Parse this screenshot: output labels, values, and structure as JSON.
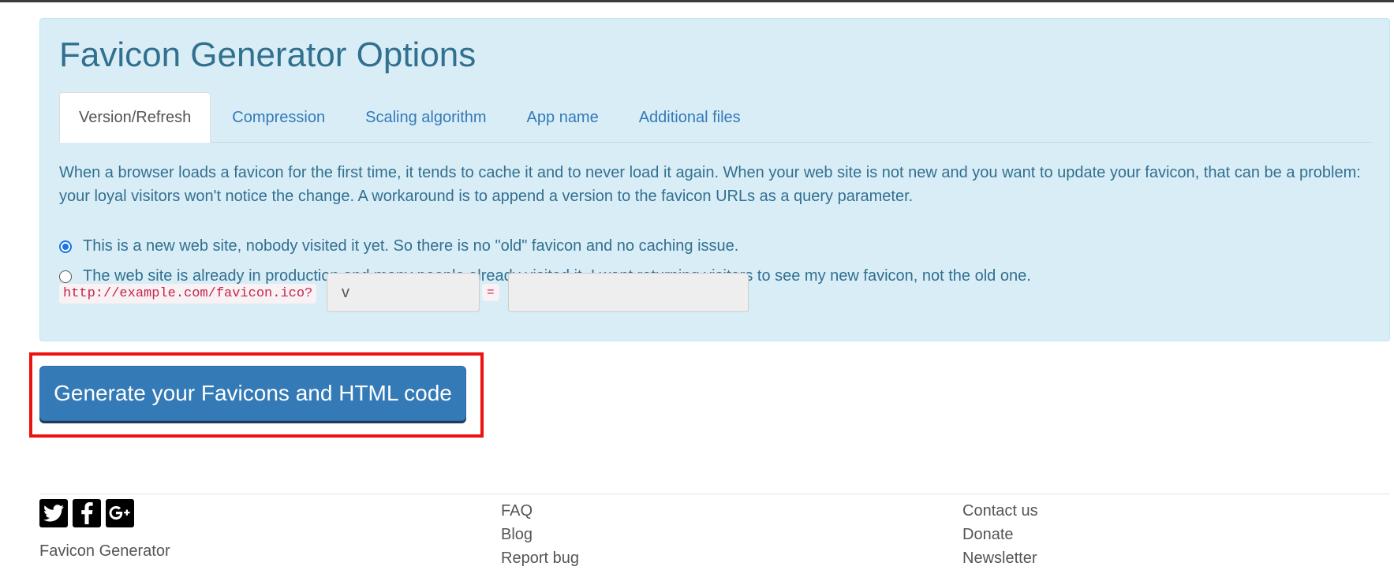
{
  "options": {
    "title": "Favicon Generator Options",
    "tabs": [
      {
        "label": "Version/Refresh",
        "active": true
      },
      {
        "label": "Compression",
        "active": false
      },
      {
        "label": "Scaling algorithm",
        "active": false
      },
      {
        "label": "App name",
        "active": false
      },
      {
        "label": "Additional files",
        "active": false
      }
    ],
    "description": "When a browser loads a favicon for the first time, it tends to cache it and to never load it again. When your web site is not new and you want to update your favicon, that can be a problem: your loyal visitors won't notice the change. A workaround is to append a version to the favicon URLs as a query parameter.",
    "radio_new_site": {
      "label": "This is a new web site, nobody visited it yet. So there is no \"old\" favicon and no caching issue.",
      "checked": true
    },
    "radio_production": {
      "label": "The web site is already in production and many people already visited it. I want returning visitors to see my new favicon, not the old one.",
      "checked": false
    },
    "url_prefix": "http://example.com/favicon.ico?",
    "param_name": "v",
    "equals_sign": "=",
    "param_value": ""
  },
  "generate_button": {
    "label": "Generate your Favicons and HTML code",
    "highlight_color": "#ee1111"
  },
  "footer": {
    "social_icons": [
      "twitter-icon",
      "facebook-icon",
      "google-plus-icon"
    ],
    "brand": "Favicon Generator",
    "links_col1": [
      "FAQ",
      "Blog",
      "Report bug"
    ],
    "links_col2": [
      "Contact us",
      "Donate",
      "Newsletter"
    ]
  },
  "colors": {
    "panel_background": "#d9edf7",
    "panel_text": "#31708f",
    "link": "#337ab7",
    "button": "#337ab7"
  }
}
